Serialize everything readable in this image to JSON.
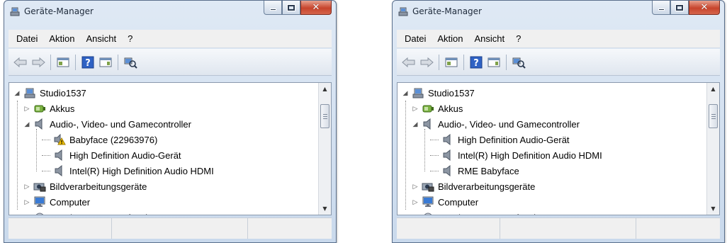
{
  "windows": [
    {
      "id": "left",
      "title": "Geräte-Manager",
      "menu": [
        "Datei",
        "Aktion",
        "Ansicht",
        "?"
      ],
      "tree": [
        {
          "label": "Studio1537",
          "level": 0,
          "expander": "expanded",
          "icon": "computer-icon"
        },
        {
          "label": "Akkus",
          "level": 1,
          "expander": "collapsed",
          "icon": "battery-icon"
        },
        {
          "label": "Audio-, Video- und Gamecontroller",
          "level": 1,
          "expander": "expanded",
          "icon": "speaker-icon"
        },
        {
          "label": "Babyface (22963976)",
          "level": 2,
          "expander": "none",
          "icon": "speaker-warning-icon"
        },
        {
          "label": "High Definition Audio-Gerät",
          "level": 2,
          "expander": "none",
          "icon": "speaker-icon"
        },
        {
          "label": "Intel(R) High Definition Audio HDMI",
          "level": 2,
          "expander": "none",
          "icon": "speaker-icon"
        },
        {
          "label": "Bildverarbeitungsgeräte",
          "level": 1,
          "expander": "collapsed",
          "icon": "camera-icon"
        },
        {
          "label": "Computer",
          "level": 1,
          "expander": "collapsed",
          "icon": "monitor-icon"
        },
        {
          "label": "DVD/CD-ROM-Laufwerke",
          "level": 1,
          "expander": "collapsed",
          "icon": "disc-icon"
        }
      ]
    },
    {
      "id": "right",
      "title": "Geräte-Manager",
      "menu": [
        "Datei",
        "Aktion",
        "Ansicht",
        "?"
      ],
      "tree": [
        {
          "label": "Studio1537",
          "level": 0,
          "expander": "expanded",
          "icon": "computer-icon"
        },
        {
          "label": "Akkus",
          "level": 1,
          "expander": "collapsed",
          "icon": "battery-icon"
        },
        {
          "label": "Audio-, Video- und Gamecontroller",
          "level": 1,
          "expander": "expanded",
          "icon": "speaker-icon"
        },
        {
          "label": "High Definition Audio-Gerät",
          "level": 2,
          "expander": "none",
          "icon": "speaker-icon"
        },
        {
          "label": "Intel(R) High Definition Audio HDMI",
          "level": 2,
          "expander": "none",
          "icon": "speaker-icon"
        },
        {
          "label": "RME Babyface",
          "level": 2,
          "expander": "none",
          "icon": "speaker-icon"
        },
        {
          "label": "Bildverarbeitungsgeräte",
          "level": 1,
          "expander": "collapsed",
          "icon": "camera-icon"
        },
        {
          "label": "Computer",
          "level": 1,
          "expander": "collapsed",
          "icon": "monitor-icon"
        },
        {
          "label": "DVD/CD-ROM-Laufwerke",
          "level": 1,
          "expander": "collapsed",
          "icon": "disc-icon"
        }
      ]
    }
  ],
  "toolbar_icons": [
    "back-arrow-icon",
    "forward-arrow-icon",
    "console-tree-icon",
    "help-icon",
    "action-pane-icon",
    "scan-hardware-icon"
  ],
  "colors": {
    "title_bar": "#c9d9ec",
    "close_button": "#c7442c",
    "warning": "#f2c200",
    "tree_background": "#ffffff"
  }
}
